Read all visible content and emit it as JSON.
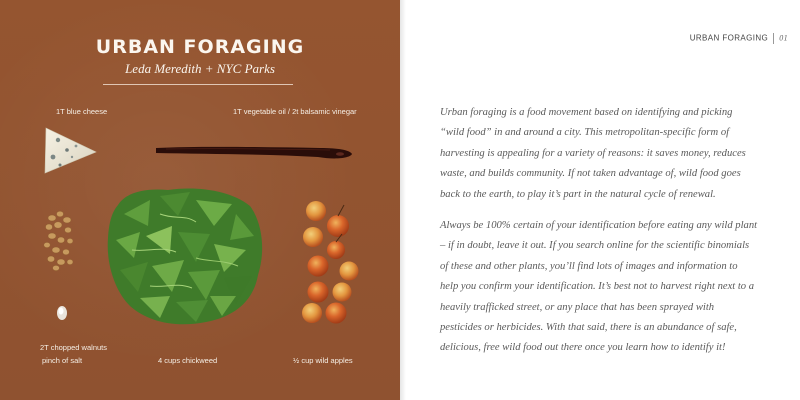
{
  "left_page": {
    "title": "URBAN FORAGING",
    "subtitle": "Leda Meredith + NYC Parks",
    "ingredients": [
      {
        "label": "1T blue cheese"
      },
      {
        "label": "1T vegetable oil / 2t balsamic vinegar"
      },
      {
        "label": "2T chopped walnuts"
      },
      {
        "label": "pinch of salt"
      },
      {
        "label": "4 cups chickweed"
      },
      {
        "label": "½ cup wild apples"
      }
    ],
    "colors": {
      "background": "#94552f",
      "text": "#f6efe6"
    }
  },
  "right_page": {
    "running_head": "URBAN FORAGING",
    "page_number": "01",
    "paragraphs": [
      "Urban foraging is a food movement based on identifying and picking “wild food” in and around a city. This metropolitan-specific form of harvesting is appealing for a variety of reasons: it saves money, reduces waste, and builds community. If not taken advantage of, wild food goes back to the earth, to play it’s part in the natural cycle of renewal.",
      "Always be 100% certain of your identification before eating any wild plant – if in doubt, leave it out. If you search online for the scientific binomials of these and other plants, you’ll find lots of images and information to help you confirm your identification. It’s best not to harvest right next to a heavily trafficked street, or any place that has been sprayed with pesticides or herbicides. With that said, there is an abundance of safe, delicious, free wild food out there once you learn how to identify it!"
    ],
    "colors": {
      "text": "#5a5a5a"
    }
  }
}
